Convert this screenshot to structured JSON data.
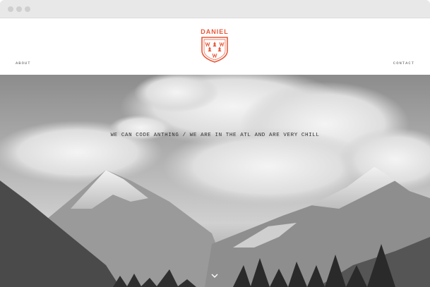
{
  "nav": {
    "about_label": "About",
    "contact_label": "Contact"
  },
  "logo": {
    "text": "DANIEL",
    "brand_color": "#e8583a"
  },
  "hero": {
    "tagline": "We can code anthing / we are in the ATL and are very chill",
    "scroll_icon": "chevron-down-icon"
  }
}
